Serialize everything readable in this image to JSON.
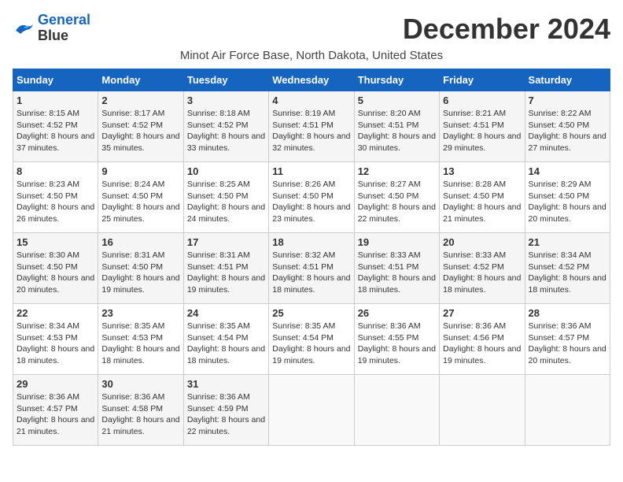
{
  "header": {
    "logo_line1": "General",
    "logo_line2": "Blue",
    "month_title": "December 2024",
    "subtitle": "Minot Air Force Base, North Dakota, United States"
  },
  "weekdays": [
    "Sunday",
    "Monday",
    "Tuesday",
    "Wednesday",
    "Thursday",
    "Friday",
    "Saturday"
  ],
  "weeks": [
    [
      {
        "day": "1",
        "sunrise": "8:15 AM",
        "sunset": "4:52 PM",
        "daylight": "8 hours and 37 minutes."
      },
      {
        "day": "2",
        "sunrise": "8:17 AM",
        "sunset": "4:52 PM",
        "daylight": "8 hours and 35 minutes."
      },
      {
        "day": "3",
        "sunrise": "8:18 AM",
        "sunset": "4:52 PM",
        "daylight": "8 hours and 33 minutes."
      },
      {
        "day": "4",
        "sunrise": "8:19 AM",
        "sunset": "4:51 PM",
        "daylight": "8 hours and 32 minutes."
      },
      {
        "day": "5",
        "sunrise": "8:20 AM",
        "sunset": "4:51 PM",
        "daylight": "8 hours and 30 minutes."
      },
      {
        "day": "6",
        "sunrise": "8:21 AM",
        "sunset": "4:51 PM",
        "daylight": "8 hours and 29 minutes."
      },
      {
        "day": "7",
        "sunrise": "8:22 AM",
        "sunset": "4:50 PM",
        "daylight": "8 hours and 27 minutes."
      }
    ],
    [
      {
        "day": "8",
        "sunrise": "8:23 AM",
        "sunset": "4:50 PM",
        "daylight": "8 hours and 26 minutes."
      },
      {
        "day": "9",
        "sunrise": "8:24 AM",
        "sunset": "4:50 PM",
        "daylight": "8 hours and 25 minutes."
      },
      {
        "day": "10",
        "sunrise": "8:25 AM",
        "sunset": "4:50 PM",
        "daylight": "8 hours and 24 minutes."
      },
      {
        "day": "11",
        "sunrise": "8:26 AM",
        "sunset": "4:50 PM",
        "daylight": "8 hours and 23 minutes."
      },
      {
        "day": "12",
        "sunrise": "8:27 AM",
        "sunset": "4:50 PM",
        "daylight": "8 hours and 22 minutes."
      },
      {
        "day": "13",
        "sunrise": "8:28 AM",
        "sunset": "4:50 PM",
        "daylight": "8 hours and 21 minutes."
      },
      {
        "day": "14",
        "sunrise": "8:29 AM",
        "sunset": "4:50 PM",
        "daylight": "8 hours and 20 minutes."
      }
    ],
    [
      {
        "day": "15",
        "sunrise": "8:30 AM",
        "sunset": "4:50 PM",
        "daylight": "8 hours and 20 minutes."
      },
      {
        "day": "16",
        "sunrise": "8:31 AM",
        "sunset": "4:50 PM",
        "daylight": "8 hours and 19 minutes."
      },
      {
        "day": "17",
        "sunrise": "8:31 AM",
        "sunset": "4:51 PM",
        "daylight": "8 hours and 19 minutes."
      },
      {
        "day": "18",
        "sunrise": "8:32 AM",
        "sunset": "4:51 PM",
        "daylight": "8 hours and 18 minutes."
      },
      {
        "day": "19",
        "sunrise": "8:33 AM",
        "sunset": "4:51 PM",
        "daylight": "8 hours and 18 minutes."
      },
      {
        "day": "20",
        "sunrise": "8:33 AM",
        "sunset": "4:52 PM",
        "daylight": "8 hours and 18 minutes."
      },
      {
        "day": "21",
        "sunrise": "8:34 AM",
        "sunset": "4:52 PM",
        "daylight": "8 hours and 18 minutes."
      }
    ],
    [
      {
        "day": "22",
        "sunrise": "8:34 AM",
        "sunset": "4:53 PM",
        "daylight": "8 hours and 18 minutes."
      },
      {
        "day": "23",
        "sunrise": "8:35 AM",
        "sunset": "4:53 PM",
        "daylight": "8 hours and 18 minutes."
      },
      {
        "day": "24",
        "sunrise": "8:35 AM",
        "sunset": "4:54 PM",
        "daylight": "8 hours and 18 minutes."
      },
      {
        "day": "25",
        "sunrise": "8:35 AM",
        "sunset": "4:54 PM",
        "daylight": "8 hours and 19 minutes."
      },
      {
        "day": "26",
        "sunrise": "8:36 AM",
        "sunset": "4:55 PM",
        "daylight": "8 hours and 19 minutes."
      },
      {
        "day": "27",
        "sunrise": "8:36 AM",
        "sunset": "4:56 PM",
        "daylight": "8 hours and 19 minutes."
      },
      {
        "day": "28",
        "sunrise": "8:36 AM",
        "sunset": "4:57 PM",
        "daylight": "8 hours and 20 minutes."
      }
    ],
    [
      {
        "day": "29",
        "sunrise": "8:36 AM",
        "sunset": "4:57 PM",
        "daylight": "8 hours and 21 minutes."
      },
      {
        "day": "30",
        "sunrise": "8:36 AM",
        "sunset": "4:58 PM",
        "daylight": "8 hours and 21 minutes."
      },
      {
        "day": "31",
        "sunrise": "8:36 AM",
        "sunset": "4:59 PM",
        "daylight": "8 hours and 22 minutes."
      },
      null,
      null,
      null,
      null
    ]
  ]
}
